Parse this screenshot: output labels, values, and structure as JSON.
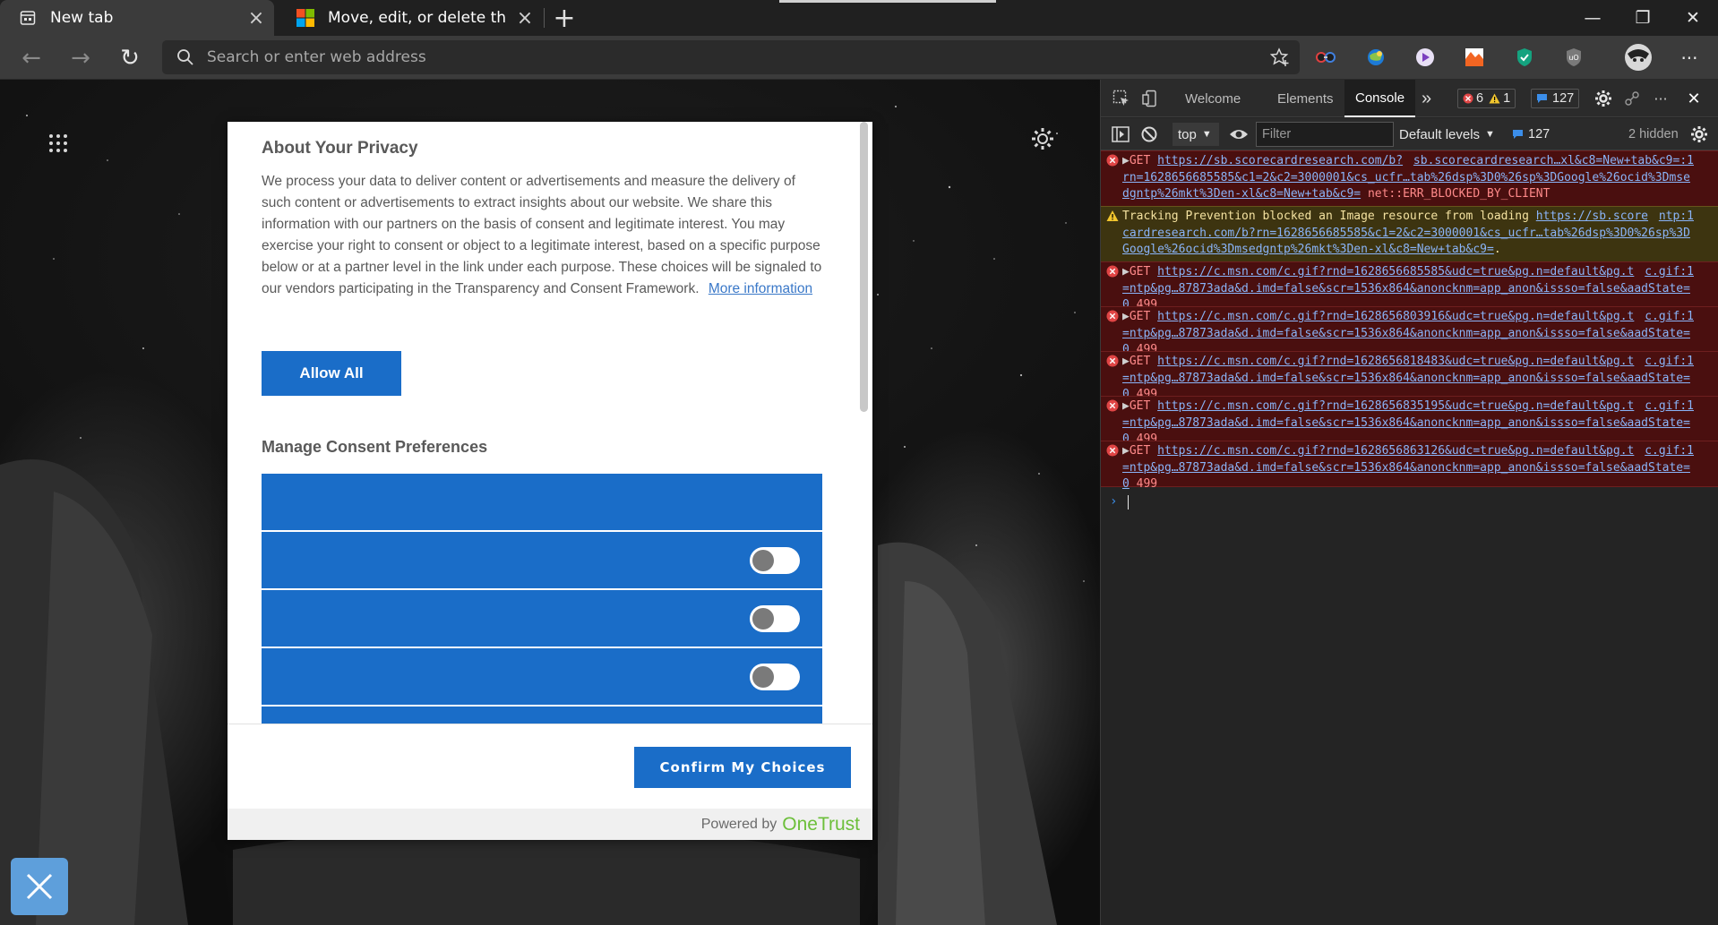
{
  "tabs": [
    {
      "title": "New tab",
      "close": "×",
      "active": true
    },
    {
      "title": "Move, edit, or delete this post",
      "close": "×",
      "active": false
    }
  ],
  "window": {
    "minimize": "—",
    "maximize": "❐",
    "close": "✕"
  },
  "address_bar": {
    "placeholder": "Search or enter web address",
    "value": ""
  },
  "nav": {
    "back": "←",
    "forward": "→",
    "refresh": "↻",
    "new_tab": "+",
    "more": "···"
  },
  "privacy_modal": {
    "title": "About Your Privacy",
    "description": "We process your data to deliver content or advertisements and measure the delivery of such content or advertisements to extract insights about our website. We share this information with our partners on the basis of consent and legitimate interest. You may exercise your right to consent or object to a legitimate interest, based on a specific purpose below or at a partner level in the link under each purpose. These choices will be signaled to our vendors participating in the Transparency and Consent Framework.",
    "more_info": "More information",
    "allow_all": "Allow All",
    "manage_title": "Manage Consent Preferences",
    "confirm": "Confirm My Choices",
    "powered_by": "Powered by",
    "brand": "OneTrust"
  },
  "devtools": {
    "tabs": [
      "Welcome",
      "Elements",
      "Console"
    ],
    "active_tab": "Console",
    "more_tabs": "»",
    "errors": "6",
    "warnings": "1",
    "messages": "127",
    "context": "top",
    "filter_placeholder": "Filter",
    "levels": "Default levels",
    "messages2": "127",
    "hidden": "2 hidden",
    "close": "✕",
    "more": "···",
    "console_messages": [
      {
        "level": "error",
        "prefix": "GET",
        "url": "https://sb.scorecardresearch.com/b?rn=1628656685585&c1=2&c2=3000001&cs_ucfr…tab%26dsp%3D0%26sp%3DGoogle%26ocid%3Dmsedgntp%26mkt%3Den-xl&c8=New+tab&c9=",
        "source": "sb.scorecardresearch…xl&c8=New+tab&c9=:1",
        "suffix": "net::ERR_BLOCKED_BY_CLIENT"
      },
      {
        "level": "warning",
        "prefix": "Tracking Prevention blocked an Image resource from loading",
        "url": "https://sb.scorecardresearch.com/b?rn=1628656685585&c1=2&c2=3000001&cs_ucfr…tab%26dsp%3D0%26sp%3DGoogle%26ocid%3Dmsedgntp%26mkt%3Den-xl&c8=New+tab&c9=",
        "source": "ntp:1",
        "suffix": "."
      },
      {
        "level": "error",
        "prefix": "GET",
        "url": "https://c.msn.com/c.gif?rnd=1628656685585&udc=true&pg.n=default&pg.t=ntp&pg…87873ada&d.imd=false&scr=1536x864&anoncknm=app_anon&issso=false&aadState=0",
        "source": "c.gif:1",
        "suffix": "499"
      },
      {
        "level": "error",
        "prefix": "GET",
        "url": "https://c.msn.com/c.gif?rnd=1628656803916&udc=true&pg.n=default&pg.t=ntp&pg…87873ada&d.imd=false&scr=1536x864&anoncknm=app_anon&issso=false&aadState=0",
        "source": "c.gif:1",
        "suffix": "499"
      },
      {
        "level": "error",
        "prefix": "GET",
        "url": "https://c.msn.com/c.gif?rnd=1628656818483&udc=true&pg.n=default&pg.t=ntp&pg…87873ada&d.imd=false&scr=1536x864&anoncknm=app_anon&issso=false&aadState=0",
        "source": "c.gif:1",
        "suffix": "499"
      },
      {
        "level": "error",
        "prefix": "GET",
        "url": "https://c.msn.com/c.gif?rnd=1628656835195&udc=true&pg.n=default&pg.t=ntp&pg…87873ada&d.imd=false&scr=1536x864&anoncknm=app_anon&issso=false&aadState=0",
        "source": "c.gif:1",
        "suffix": "499"
      },
      {
        "level": "error",
        "prefix": "GET",
        "url": "https://c.msn.com/c.gif?rnd=1628656863126&udc=true&pg.n=default&pg.t=ntp&pg…87873ada&d.imd=false&scr=1536x864&anoncknm=app_anon&issso=false&aadState=0",
        "source": "c.gif:1",
        "suffix": "499"
      }
    ]
  },
  "colors": {
    "accent_blue": "#1a6dc8",
    "onetrust_green": "#6cbf3a",
    "error_bg": "#4a0f0f",
    "warning_bg": "#3d3410"
  }
}
